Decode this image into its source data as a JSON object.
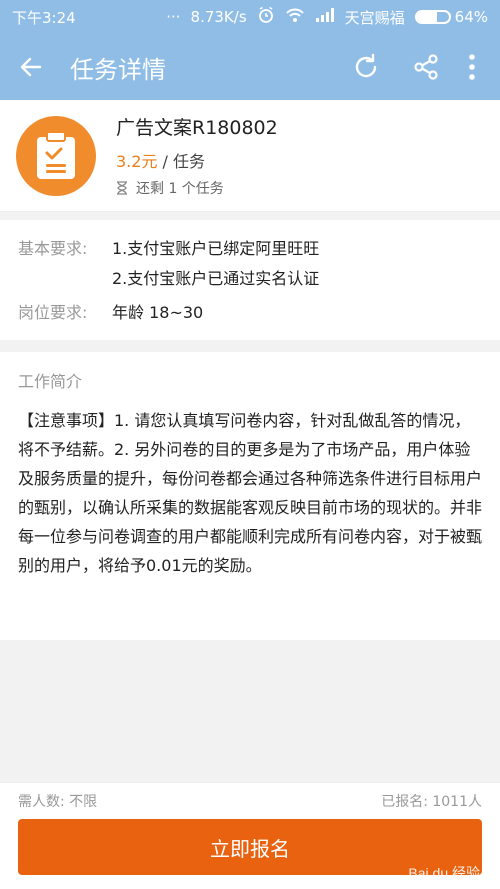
{
  "status_bar": {
    "time": "下午3:24",
    "dots": "···",
    "speed": "8.73K/s",
    "carrier": "天宫赐福",
    "battery": "64%",
    "battery_level": 0.64
  },
  "header": {
    "title": "任务详情"
  },
  "task": {
    "name": "广告文案R180802",
    "price": "3.2元",
    "price_unit": " / 任务",
    "remaining": "还剩 1 个任务"
  },
  "requirements": {
    "basic_label": "基本要求:",
    "basic_items": [
      "1.支付宝账户已绑定阿里旺旺",
      "2.支付宝账户已通过实名认证"
    ],
    "position_label": "岗位要求:",
    "position_value": "年龄 18~30"
  },
  "description": {
    "title": "工作简介",
    "body": "【注意事项】1. 请您认真填写问卷内容，针对乱做乱答的情况，将不予结薪。2. 另外问卷的目的更多是为了市场产品，用户体验及服务质量的提升，每份问卷都会通过各种筛选条件进行目标用户的甄别，以确认所采集的数据能客观反映目前市场的现状的。并非每一位参与问卷调查的用户都能顺利完成所有问卷内容，对于被甄别的用户，将给予0.01元的奖励。"
  },
  "footer": {
    "needed": "需人数: 不限",
    "signed": "已报名: 1011人",
    "button": "立即报名",
    "watermark": "Bai du 经验"
  },
  "colors": {
    "header_bg": "#8fbde6",
    "accent_orange": "#e8620f",
    "price_orange": "#e8801c",
    "icon_orange": "#f08c2c"
  }
}
